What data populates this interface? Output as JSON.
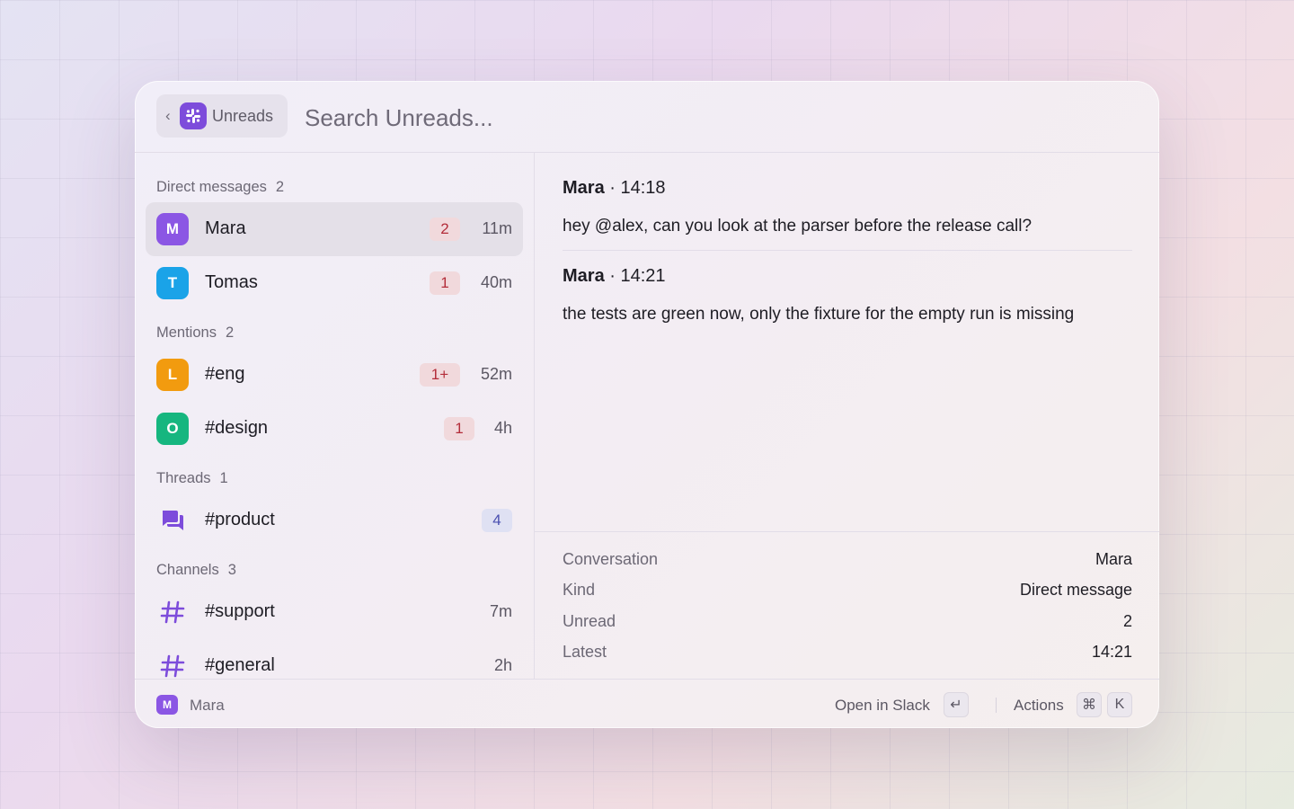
{
  "header": {
    "back_glyph": "‹",
    "breadcrumb_label": "Unreads",
    "breadcrumb_icon": "slack-icon",
    "search_placeholder": "Search Unreads..."
  },
  "sections": [
    {
      "title": "Direct messages",
      "count": "2",
      "items": [
        {
          "avatar": "M",
          "avatar_color": "#8b56e4",
          "label": "Mara",
          "badge": "2",
          "badge_style": "red",
          "time": "11m",
          "selected": true
        },
        {
          "avatar": "T",
          "avatar_color": "#1aa3e8",
          "label": "Tomas",
          "badge": "1",
          "badge_style": "red",
          "time": "40m"
        }
      ]
    },
    {
      "title": "Mentions",
      "count": "2",
      "items": [
        {
          "avatar": "L",
          "avatar_color": "#f29b0f",
          "label": "#eng",
          "badge": "1+",
          "badge_style": "red",
          "time": "52m"
        },
        {
          "avatar": "O",
          "avatar_color": "#16b67f",
          "label": "#design",
          "badge": "1",
          "badge_style": "red",
          "time": "4h"
        }
      ]
    },
    {
      "title": "Threads",
      "count": "1",
      "items": [
        {
          "icon": "thread-icon",
          "label": "#product",
          "badge": "4",
          "badge_style": "blue",
          "time": ""
        }
      ]
    },
    {
      "title": "Channels",
      "count": "3",
      "items": [
        {
          "icon": "hash-icon",
          "label": "#support",
          "time": "7m"
        },
        {
          "icon": "hash-icon",
          "label": "#general",
          "time": "2h"
        }
      ]
    }
  ],
  "messages": [
    {
      "author": "Mara",
      "time": "· 14:18",
      "text": "hey @alex, can you look at the parser before the release call?"
    },
    {
      "author": "Mara",
      "time": "· 14:21",
      "text": "the tests are green now, only the fixture for the empty run is missing"
    }
  ],
  "metadata": [
    {
      "key": "Conversation",
      "value": "Mara"
    },
    {
      "key": "Kind",
      "value": "Direct message"
    },
    {
      "key": "Unread",
      "value": "2"
    },
    {
      "key": "Latest",
      "value": "14:21"
    }
  ],
  "footer": {
    "user_avatar": "M",
    "user_name": "Mara",
    "open_label": "Open in Slack",
    "open_key": "↵",
    "actions_label": "Actions",
    "actions_key_1": "⌘",
    "actions_key_2": "K"
  },
  "colors": {
    "accent": "#7d4cdb",
    "badge_red_bg": "#f1d9dc",
    "badge_red_text": "#b32d3a",
    "badge_blue_bg": "#dfe1f3",
    "badge_blue_text": "#4a4fb0",
    "selected_row": "#e4e0e8"
  }
}
